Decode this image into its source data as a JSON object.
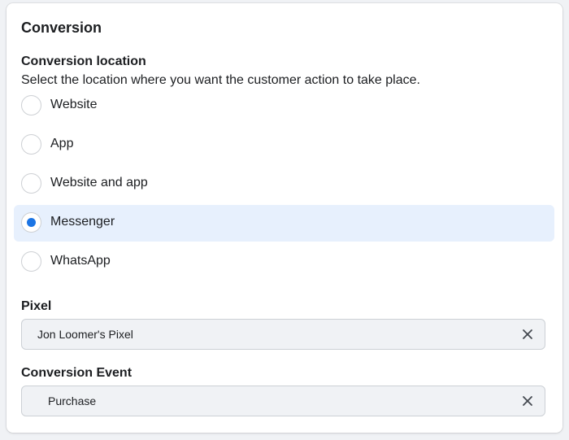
{
  "section": {
    "title": "Conversion"
  },
  "conversion_location": {
    "label": "Conversion location",
    "description": "Select the location where you want the customer action to take place.",
    "options": [
      {
        "label": "Website",
        "selected": false
      },
      {
        "label": "App",
        "selected": false
      },
      {
        "label": "Website and app",
        "selected": false
      },
      {
        "label": "Messenger",
        "selected": true
      },
      {
        "label": "WhatsApp",
        "selected": false
      }
    ]
  },
  "pixel": {
    "label": "Pixel",
    "value": "Jon Loomer's Pixel",
    "clear_icon": "close-icon"
  },
  "conversion_event": {
    "label": "Conversion Event",
    "value": "Purchase",
    "clear_icon": "close-icon"
  },
  "colors": {
    "accent": "#1b74e4",
    "selected_bg": "#e7f0fd",
    "input_bg": "#f0f2f5"
  }
}
